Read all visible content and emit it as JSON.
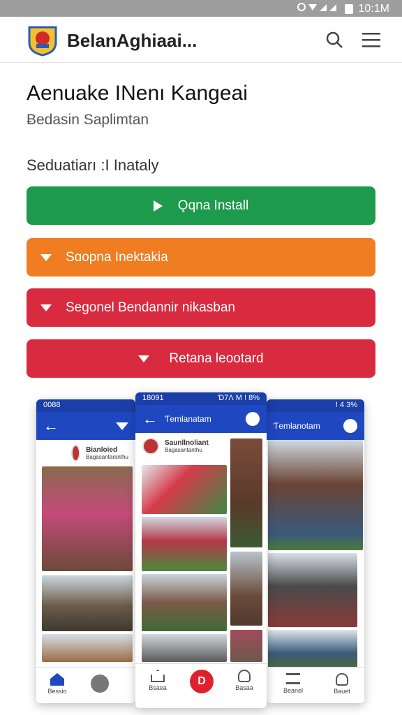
{
  "status_bar": {
    "time": "10:1M"
  },
  "app_bar": {
    "title": "BelanAghiaai...",
    "search_icon": "search-icon",
    "menu_icon": "menu-icon"
  },
  "page": {
    "title": "Aenuake INenı Kangeai",
    "subtitle": "Ƀedasin Saplimtan",
    "section_label": "Seduatiarı :I Inataly"
  },
  "buttons": [
    {
      "label": "Ǫqna Install",
      "color": "#1e9a4c"
    },
    {
      "label": "Sɑopna Inektakia",
      "color": "#f07d22"
    },
    {
      "label": "Segonel Bendannir nikasban",
      "color": "#d92b3f"
    },
    {
      "label": "Retana leootard",
      "color": "#d92b3f"
    }
  ],
  "phones": {
    "left": {
      "status_left": "0088 ",
      "profile_name": "Bianloied",
      "profile_sub": "Bagasantaranthu",
      "nav": [
        "Bessio",
        ""
      ]
    },
    "middle": {
      "status_left": "18091 ",
      "status_right": "Ɗ7Ʌ M ǃ 8% ",
      "header_title": "Ƭemlanatam",
      "profile_name": "Saunllnoliant",
      "profile_sub": "Bagasantanthu",
      "nav": [
        "Bsaea",
        "Basaa"
      ],
      "fab_label": "D"
    },
    "right": {
      "status_right": "ǃ 4 3% ",
      "header_title": "Ƭemlanotam",
      "nav": [
        "Beanel",
        "Bauet"
      ]
    }
  }
}
